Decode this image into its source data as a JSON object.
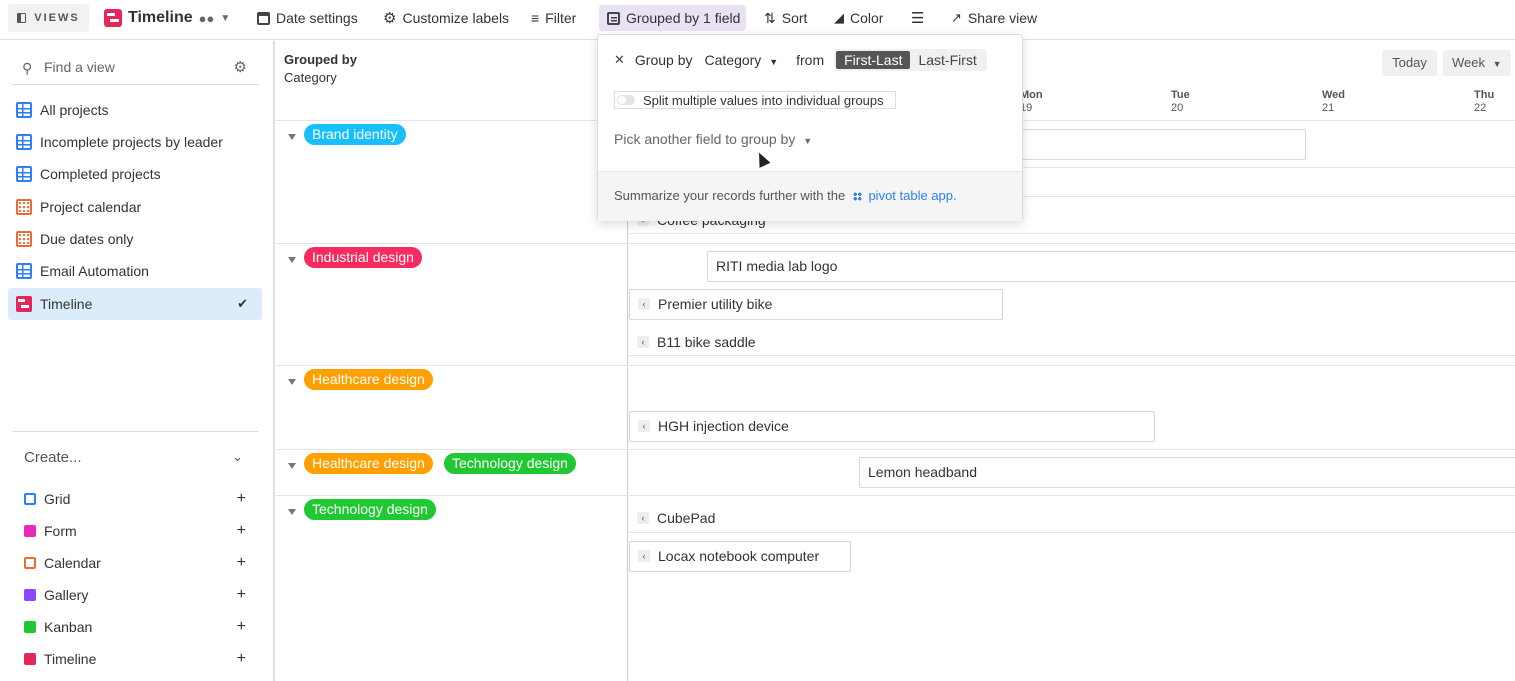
{
  "toolbar": {
    "views_label": "VIEWS",
    "view_title": "Timeline",
    "date_settings": "Date settings",
    "customize_labels": "Customize labels",
    "filter": "Filter",
    "grouped": "Grouped by 1 field",
    "sort": "Sort",
    "color": "Color",
    "share_view": "Share view"
  },
  "sidebar": {
    "search_placeholder": "Find a view",
    "views": [
      {
        "label": "All projects",
        "icon": "grid"
      },
      {
        "label": "Incomplete projects by leader",
        "icon": "grid"
      },
      {
        "label": "Completed projects",
        "icon": "grid"
      },
      {
        "label": "Project calendar",
        "icon": "calendar"
      },
      {
        "label": "Due dates only",
        "icon": "calendar"
      },
      {
        "label": "Email Automation",
        "icon": "grid"
      },
      {
        "label": "Timeline",
        "icon": "timeline",
        "active": true
      }
    ],
    "create_label": "Create...",
    "create_items": [
      {
        "label": "Grid",
        "color": "#2d7ff9"
      },
      {
        "label": "Form",
        "color": "#e929ba"
      },
      {
        "label": "Calendar",
        "color": "#f06a35"
      },
      {
        "label": "Gallery",
        "color": "#8b46ff"
      },
      {
        "label": "Kanban",
        "color": "#20c933"
      },
      {
        "label": "Timeline",
        "color": "#e3275b"
      }
    ]
  },
  "group_column": {
    "title_bold": "Grouped by",
    "title_field": "Category",
    "groups": [
      {
        "pills": [
          {
            "label": "Brand identity",
            "color": "#18bfff"
          }
        ]
      },
      {
        "pills": [
          {
            "label": "Industrial design",
            "color": "#f82b60"
          }
        ]
      },
      {
        "pills": [
          {
            "label": "Healthcare design",
            "color": "#ff9f00"
          }
        ]
      },
      {
        "pills": [
          {
            "label": "Healthcare design",
            "color": "#ff9f00"
          },
          {
            "label": "Technology design",
            "color": "#20c933"
          }
        ]
      },
      {
        "pills": [
          {
            "label": "Technology design",
            "color": "#20c933"
          }
        ]
      }
    ]
  },
  "timeline": {
    "days": [
      {
        "name": "Mon",
        "num": "19"
      },
      {
        "name": "Tue",
        "num": "20"
      },
      {
        "name": "Wed",
        "num": "21"
      },
      {
        "name": "Thu",
        "num": "22"
      }
    ],
    "today_label": "Today",
    "week_label": "Week",
    "records": {
      "coffee": "Coffee packaging",
      "riti": "RITI media lab logo",
      "premier": "Premier utility bike",
      "b11": "B11 bike saddle",
      "hgh": "HGH injection device",
      "lemon": "Lemon headband",
      "cubepad": "CubePad",
      "locax": "Locax notebook computer"
    }
  },
  "popup": {
    "group_by_label": "Group by",
    "field": "Category",
    "from_label": "from",
    "order_options": [
      "First-Last",
      "Last-First"
    ],
    "selected_order": "First-Last",
    "split_label": "Split multiple values into individual groups",
    "pick_another": "Pick another field to group by",
    "footer_text": "Summarize your records further with the",
    "footer_link": "pivot table app",
    "footer_end": "."
  }
}
